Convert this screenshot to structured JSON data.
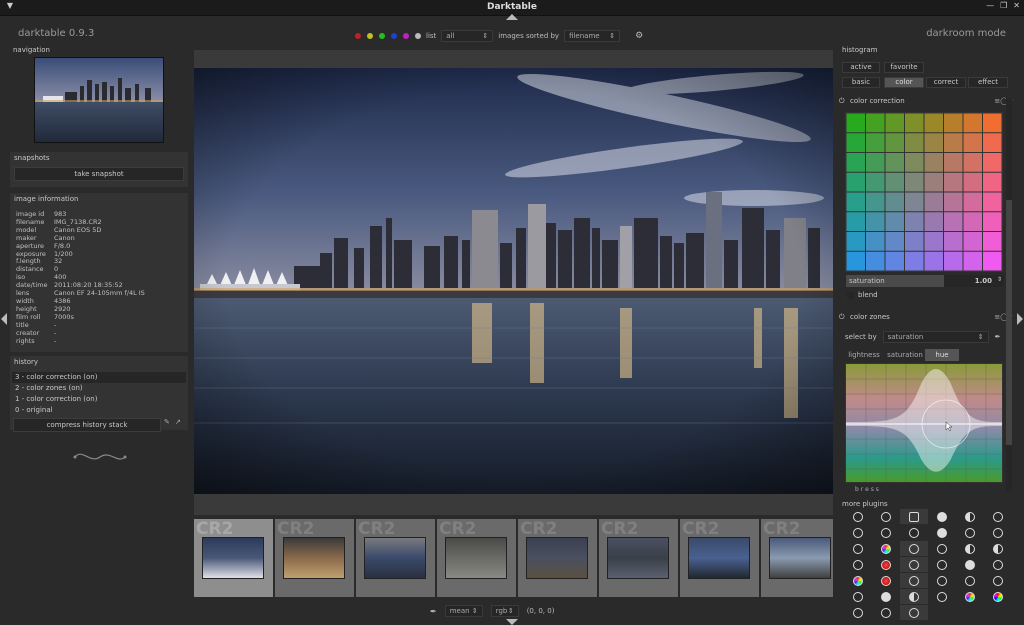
{
  "window": {
    "title": "Darktable"
  },
  "app": {
    "name": "darktable 0.9.3",
    "mode": "darkroom mode"
  },
  "topbar": {
    "color_labels": [
      "#c02020",
      "#c0c020",
      "#20c020",
      "#2040d0",
      "#c020c0",
      "#bbbbbb"
    ],
    "list_label": "list",
    "list_value": "all",
    "sorted_label": "images sorted by",
    "sorted_value": "filename"
  },
  "left": {
    "navigation_title": "navigation",
    "snapshots_title": "snapshots",
    "take_snapshot": "take snapshot",
    "image_info_title": "image information",
    "image_info": [
      {
        "k": "image id",
        "v": "983"
      },
      {
        "k": "filename",
        "v": "IMG_7138.CR2"
      },
      {
        "k": "model",
        "v": "Canon EOS 5D"
      },
      {
        "k": "maker",
        "v": "Canon"
      },
      {
        "k": "aperture",
        "v": "F/8.0"
      },
      {
        "k": "exposure",
        "v": "1/200"
      },
      {
        "k": "f.length",
        "v": "32"
      },
      {
        "k": "distance",
        "v": "0"
      },
      {
        "k": "iso",
        "v": "400"
      },
      {
        "k": "date/time",
        "v": "2011:08:20 18:35:52"
      },
      {
        "k": "lens",
        "v": "Canon EF 24-105mm f/4L IS"
      },
      {
        "k": "width",
        "v": "4386"
      },
      {
        "k": "height",
        "v": "2920"
      },
      {
        "k": "film roll",
        "v": "7000s"
      },
      {
        "k": "title",
        "v": "-"
      },
      {
        "k": "creator",
        "v": "-"
      },
      {
        "k": "rights",
        "v": "-"
      }
    ],
    "history_title": "history",
    "history": [
      {
        "label": "3 - color correction (on)",
        "active": true
      },
      {
        "label": "2 - color zones (on)",
        "active": false
      },
      {
        "label": "1 - color correction (on)",
        "active": false
      },
      {
        "label": "0 - original",
        "active": false
      }
    ],
    "compress_history": "compress history stack"
  },
  "filmstrip": {
    "badge": "CR2",
    "count": 8,
    "selected_index": 0
  },
  "bottombar": {
    "mode": "mean",
    "space": "rgb",
    "value": "(0, 0, 0)"
  },
  "right": {
    "histogram_title": "histogram",
    "tabs_row1": [
      "active",
      "favorite"
    ],
    "tabs_row2": [
      "basic",
      "color",
      "correct",
      "effect"
    ],
    "active_tab": "color",
    "color_correction": {
      "title": "color correction",
      "saturation_label": "saturation",
      "saturation_value": "1.00",
      "blend_label": "blend"
    },
    "color_zones": {
      "title": "color zones",
      "select_by_label": "select by",
      "select_by_value": "saturation",
      "tabs": [
        "lightness",
        "saturation",
        "hue"
      ],
      "active_tab": "hue",
      "bottom_label": "b r e s s"
    },
    "more_plugins_title": "more plugins"
  }
}
